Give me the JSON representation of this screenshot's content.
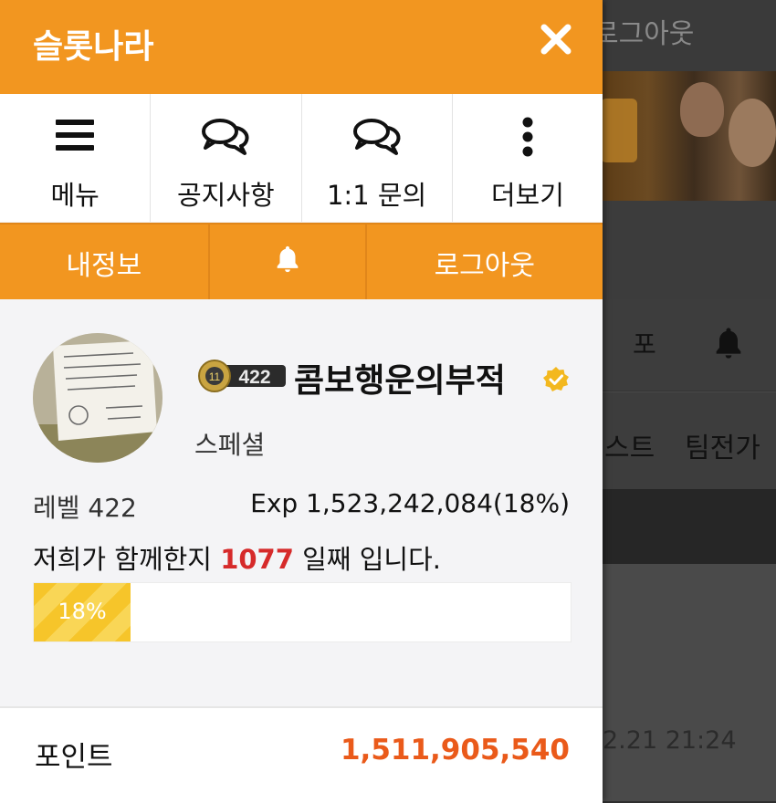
{
  "background": {
    "logout_text": "로그아웃",
    "po_text": "포",
    "tab1": "스트",
    "tab2": "팀전가",
    "date": "2.21 21:24"
  },
  "drawer": {
    "title": "슬롯나라",
    "close_icon": "close-icon",
    "nav": [
      {
        "label": "메뉴",
        "icon": "hamburger-icon"
      },
      {
        "label": "공지사항",
        "icon": "chat-bubbles-icon"
      },
      {
        "label": "1:1 문의",
        "icon": "chat-bubbles-icon"
      },
      {
        "label": "더보기",
        "icon": "more-vertical-icon"
      }
    ],
    "actions": {
      "my_info": "내정보",
      "bell_icon": "bell-icon",
      "logout": "로그아웃"
    }
  },
  "profile": {
    "level_badge": "422",
    "nickname": "콤보행운의부적",
    "grade": "스페셜",
    "level_text": "레벨 422",
    "exp_text": "Exp 1,523,242,084(18%)",
    "days_prefix": "저희가 함께한지 ",
    "days_count": "1077",
    "days_suffix": " 일째 입니다.",
    "progress_label": "18%",
    "progress_fraction": 0.18
  },
  "points": {
    "label": "포인트",
    "value": "1,511,905,540"
  },
  "colors": {
    "accent": "#f29620",
    "days_highlight": "#d62a2a",
    "points_value": "#ea5a1a",
    "progress": "#f6c52a"
  }
}
